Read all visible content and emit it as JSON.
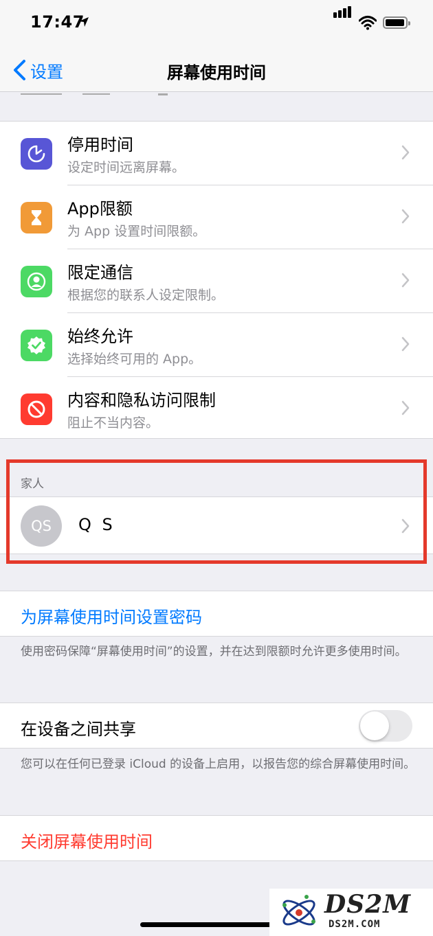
{
  "status_bar": {
    "time": "17:47"
  },
  "nav": {
    "back_label": "设置",
    "title": "屏幕使用时间"
  },
  "settings": [
    {
      "title": "停用时间",
      "subtitle": "设定时间远离屏幕。",
      "icon": "downtime-icon",
      "color": "#5856d6"
    },
    {
      "title": "App限额",
      "subtitle": "为 App 设置时间限额。",
      "icon": "hourglass-icon",
      "color": "#f19a37"
    },
    {
      "title": "限定通信",
      "subtitle": "根据您的联系人设定限制。",
      "icon": "contact-icon",
      "color": "#4cd964"
    },
    {
      "title": "始终允许",
      "subtitle": "选择始终可用的 App。",
      "icon": "checkmark-badge-icon",
      "color": "#4cd964"
    },
    {
      "title": "内容和隐私访问限制",
      "subtitle": "阻止不当内容。",
      "icon": "restriction-icon",
      "color": "#ff3b30"
    }
  ],
  "family": {
    "header": "家人",
    "member": {
      "initials": "QS",
      "name": "Q S"
    }
  },
  "passcode": {
    "label": "为屏幕使用时间设置密码",
    "footer": "使用密码保障“屏幕使用时间”的设置，并在达到限额时允许更多使用时间。"
  },
  "share": {
    "label": "在设备之间共享",
    "enabled": false,
    "footer": "您可以在任何已登录 iCloud 的设备上启用，以报告您的综合屏幕使用时间。"
  },
  "turn_off": {
    "label": "关闭屏幕使用时间"
  },
  "watermark": {
    "brand": "DS2M",
    "url": "DS2M.COM"
  },
  "colors": {
    "accent": "#007aff",
    "destructive": "#ff3b30",
    "highlight": "#e4392b"
  }
}
